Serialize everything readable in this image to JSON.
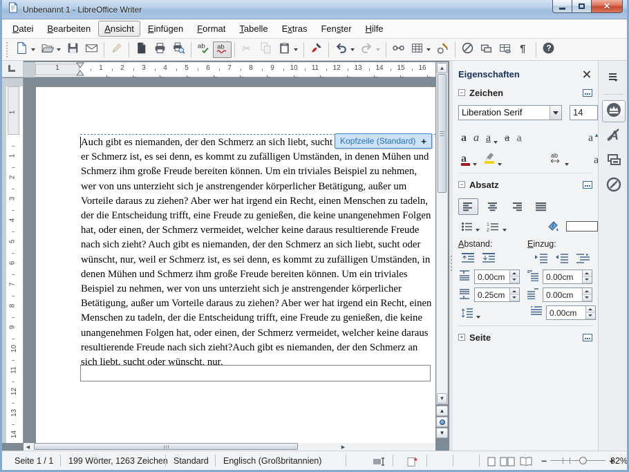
{
  "window": {
    "title": "Unbenannt 1 - LibreOffice Writer"
  },
  "menubar": {
    "active": "Ansicht",
    "items": [
      {
        "label": "Datei",
        "accel": 0
      },
      {
        "label": "Bearbeiten",
        "accel": 0
      },
      {
        "label": "Ansicht",
        "accel": 0
      },
      {
        "label": "Einfügen",
        "accel": 0
      },
      {
        "label": "Format",
        "accel": 0
      },
      {
        "label": "Tabelle",
        "accel": 0
      },
      {
        "label": "Extras",
        "accel": 1
      },
      {
        "label": "Fenster",
        "accel": 3
      },
      {
        "label": "Hilfe",
        "accel": 0
      }
    ]
  },
  "toolbar": {
    "buttons": [
      {
        "name": "new-document",
        "dropdown": true
      },
      {
        "name": "open",
        "dropdown": true
      },
      {
        "name": "save"
      },
      {
        "name": "email"
      },
      {
        "sep": true
      },
      {
        "name": "edit-file",
        "disabled": true
      },
      {
        "sep": true
      },
      {
        "name": "export-pdf"
      },
      {
        "name": "print"
      },
      {
        "name": "print-preview"
      },
      {
        "sep": true
      },
      {
        "name": "spelling"
      },
      {
        "name": "auto-spellcheck",
        "pressed": true
      },
      {
        "sep": true
      },
      {
        "name": "cut",
        "disabled": true
      },
      {
        "name": "copy",
        "disabled": true
      },
      {
        "name": "paste",
        "dropdown": true
      },
      {
        "sep": true
      },
      {
        "name": "clone-formatting"
      },
      {
        "sep": true
      },
      {
        "name": "undo",
        "dropdown": true
      },
      {
        "name": "redo",
        "disabled": true,
        "dropdown": true
      },
      {
        "sep": true
      },
      {
        "name": "hyperlink"
      },
      {
        "name": "table",
        "dropdown": true
      },
      {
        "name": "draw-functions"
      },
      {
        "sep": true
      },
      {
        "name": "navigator"
      },
      {
        "name": "gallery"
      },
      {
        "name": "data-sources"
      },
      {
        "name": "formatting-marks"
      },
      {
        "sep": true
      },
      {
        "name": "help"
      }
    ]
  },
  "ruler": {
    "h_margin": "1",
    "h_numbers": [
      "1",
      "2",
      "3",
      "4",
      "5",
      "6",
      "7",
      "8",
      "9",
      "10",
      "11",
      "12",
      "13",
      "14",
      "15",
      "16"
    ],
    "v_margin": "1",
    "v_numbers": [
      "1",
      "2",
      "3",
      "4",
      "5",
      "6",
      "7",
      "8",
      "9",
      "10",
      "11",
      "12",
      "13",
      "14"
    ]
  },
  "document": {
    "header_button": {
      "label": "Kopfzeile (Standard)",
      "plus": "+"
    },
    "text": "Auch gibt es niemanden, der den Schmerz an sich liebt, sucht oder wünscht, nur, weil\ner Schmerz ist, es sei denn, es kommt zu zufälligen Umständen, in denen Mühen und\nSchmerz ihm große Freude bereiten können. Um ein triviales Beispiel zu nehmen,\nwer von uns unterzieht sich je anstrengender körperlicher Betätigung, außer um\nVorteile daraus zu ziehen? Aber wer hat irgend ein Recht, einen Menschen zu tadeln,\nder die Entscheidung trifft, eine Freude zu genießen, die keine unangenehmen Folgen\nhat, oder einen, der Schmerz vermeidet, welcher keine daraus resultierende Freude\nnach sich zieht? Auch gibt es niemanden, der den Schmerz an sich liebt, sucht oder\nwünscht, nur, weil er Schmerz ist, es sei denn, es kommt zu zufälligen Umständen, in\ndenen Mühen und Schmerz ihm große Freude bereiten können. Um ein triviales\nBeispiel zu nehmen, wer von uns unterzieht sich je anstrengender körperlicher\nBetätigung, außer um Vorteile daraus zu ziehen? Aber wer hat irgend ein Recht, einen\nMenschen zu tadeln, der die Entscheidung trifft, eine Freude zu genießen, die keine\nunangenehmen Folgen hat, oder einen, der Schmerz vermeidet, welcher keine daraus\nresultierende Freude nach sich zieht?Auch gibt es niemanden, der den Schmerz an\nsich liebt, sucht oder wünscht, nur,"
  },
  "sidebar": {
    "title": "Eigenschaften",
    "zeichen": {
      "title": "Zeichen",
      "font_name": "Liberation Serif",
      "font_size": "14"
    },
    "absatz": {
      "title": "Absatz",
      "spacing_label": "Abstand:",
      "indent_label": "Einzug:",
      "above_spacing": "0.00cm",
      "below_spacing": "0.25cm",
      "before_indent": "0.00cm",
      "after_indent": "0.00cm",
      "first_line_indent": "0.00cm"
    },
    "seite": {
      "title": "Seite"
    }
  },
  "statusbar": {
    "page": "Seite 1 / 1",
    "count": "199 Wörter, 1263 Zeichen",
    "style": "Standard",
    "language": "Englisch (Großbritannien)",
    "zoom": "82%"
  }
}
